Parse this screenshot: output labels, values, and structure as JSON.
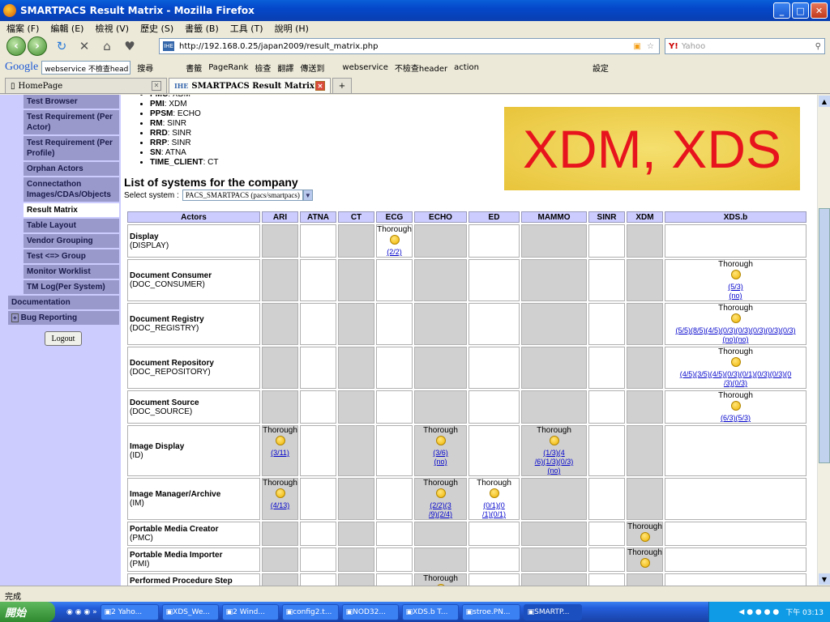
{
  "window": {
    "title": "SMARTPACS Result Matrix - Mozilla Firefox"
  },
  "menu": [
    "檔案 (F)",
    "編輯 (E)",
    "檢視 (V)",
    "歷史 (S)",
    "書籤 (B)",
    "工具 (T)",
    "說明 (H)"
  ],
  "nav": {
    "url": "http://192.168.0.25/japan2009/result_matrix.php",
    "search_placeholder": "Yahoo"
  },
  "google": {
    "label": "Google",
    "input": "webservice 不檢查head",
    "items": [
      "搜尋",
      "書籤",
      "PageRank",
      "檢查",
      "翻譯",
      "傳送到",
      "webservice",
      "不檢查header",
      "action",
      "設定"
    ]
  },
  "tabs": [
    {
      "label": "HomePage"
    },
    {
      "label": "SMARTPACS Result Matrix"
    }
  ],
  "sidebar": {
    "items": [
      "Test Browser",
      "Test Requirement (Per Actor)",
      "Test Requirement (Per Profile)",
      "Orphan Actors",
      "Connectathon Images/CDAs/Objects",
      "Result Matrix",
      "Table Layout",
      "Vendor Grouping",
      "Test <=> Group",
      "Monitor Worklist",
      "TM Log(Per System)"
    ],
    "top1": "Documentation",
    "top2": "Bug Reporting",
    "logout": "Logout"
  },
  "bullets": [
    {
      "k": "PMC",
      "v": ": XDM"
    },
    {
      "k": "PMI",
      "v": ": XDM"
    },
    {
      "k": "PPSM",
      "v": ": ECHO"
    },
    {
      "k": "RM",
      "v": ": SINR"
    },
    {
      "k": "RRD",
      "v": ": SINR"
    },
    {
      "k": "RRP",
      "v": ": SINR"
    },
    {
      "k": "SN",
      "v": ": ATNA"
    },
    {
      "k": "TIME_CLIENT",
      "v": ": CT"
    }
  ],
  "banner": "XDM, XDS",
  "heading": "List of systems for the company",
  "select": {
    "label": "Select system :",
    "value": "PACS_SMARTPACS (pacs/smartpacs)"
  },
  "matrix": {
    "columns": [
      "Actors",
      "ARI",
      "ATNA",
      "CT",
      "ECG",
      "ECHO",
      "ED",
      "MAMMO",
      "SINR",
      "XDM",
      "XDS.b"
    ],
    "rows": [
      {
        "name": "Display",
        "code": "(DISPLAY)",
        "cells": [
          "g",
          "w",
          "g",
          "t",
          "g",
          "w",
          "g",
          "w",
          "g",
          "w"
        ],
        "results": {
          "3": {
            "links": [
              "(2/2)"
            ]
          }
        }
      },
      {
        "name": "Document Consumer",
        "code": "(DOC_CONSUMER)",
        "cells": [
          "g",
          "w",
          "g",
          "w",
          "g",
          "w",
          "g",
          "w",
          "g",
          "t"
        ],
        "results": {
          "9": {
            "links": [
              "(5/3)",
              "(no)"
            ]
          }
        }
      },
      {
        "name": "Document Registry",
        "code": "(DOC_REGISTRY)",
        "cells": [
          "g",
          "w",
          "g",
          "w",
          "g",
          "w",
          "g",
          "w",
          "g",
          "t"
        ],
        "results": {
          "9": {
            "links": [
              "(5/5)(8/5)(4/5)(0/3)(0/3)(0/3)(0/3)(0/3)",
              "(no)(no)"
            ]
          }
        }
      },
      {
        "name": "Document Repository",
        "code": "(DOC_REPOSITORY)",
        "cells": [
          "g",
          "w",
          "g",
          "w",
          "g",
          "w",
          "g",
          "w",
          "g",
          "t"
        ],
        "results": {
          "9": {
            "links": [
              "(4/5)(3/5)(4/5)(0/3)(0/1)(0/3)(0/3)(0",
              "/3)(0/3)"
            ]
          }
        }
      },
      {
        "name": "Document Source",
        "code": "(DOC_SOURCE)",
        "cells": [
          "g",
          "w",
          "g",
          "w",
          "g",
          "w",
          "g",
          "w",
          "g",
          "t"
        ],
        "results": {
          "9": {
            "links": [
              "(6/3)(5/3)"
            ]
          }
        }
      },
      {
        "name": "Image Display",
        "code": "(ID)",
        "cells": [
          "t",
          "w",
          "g",
          "w",
          "t",
          "w",
          "t",
          "w",
          "g",
          "w"
        ],
        "results": {
          "0": {
            "links": [
              "(3/11)"
            ]
          },
          "4": {
            "links": [
              "(3/6)",
              "(no)"
            ]
          },
          "6": {
            "links": [
              "(1/3)(4",
              "/6)(1/3)(0/3)",
              "(no)"
            ]
          }
        }
      },
      {
        "name": "Image Manager/Archive",
        "code": "(IM)",
        "cells": [
          "t",
          "w",
          "g",
          "w",
          "t",
          "t",
          "g",
          "w",
          "g",
          "w"
        ],
        "results": {
          "0": {
            "links": [
              "(4/13)"
            ]
          },
          "4": {
            "links": [
              "(2/2)(3",
              "/9)(2/4)"
            ]
          },
          "5": {
            "links": [
              "(0/1)(0",
              "/1)(0/1)"
            ]
          }
        }
      },
      {
        "name": "Portable Media Creator",
        "code": "(PMC)",
        "cells": [
          "g",
          "w",
          "g",
          "w",
          "g",
          "w",
          "g",
          "w",
          "t",
          "w"
        ],
        "results": {
          "8": {
            "links": []
          }
        }
      },
      {
        "name": "Portable Media Importer",
        "code": "(PMI)",
        "cells": [
          "g",
          "w",
          "g",
          "w",
          "g",
          "w",
          "g",
          "w",
          "t",
          "w"
        ],
        "results": {
          "8": {
            "links": []
          }
        }
      },
      {
        "name": "Performed Procedure Step Manager",
        "code": "",
        "cells": [
          "g",
          "w",
          "g",
          "w",
          "t",
          "w",
          "g",
          "w",
          "g",
          "w"
        ],
        "results": {
          "4": {
            "links": []
          }
        }
      }
    ],
    "thorough": "Thorough"
  },
  "status": "完成",
  "taskbar": {
    "start": "開始",
    "items": [
      "2 Yaho...",
      "XDS_We...",
      "2 Wind...",
      "config2.t...",
      "NOD32...",
      "XDS.b T...",
      "stroe.PN...",
      "SMARTP..."
    ],
    "clock": "下午 03:13"
  }
}
